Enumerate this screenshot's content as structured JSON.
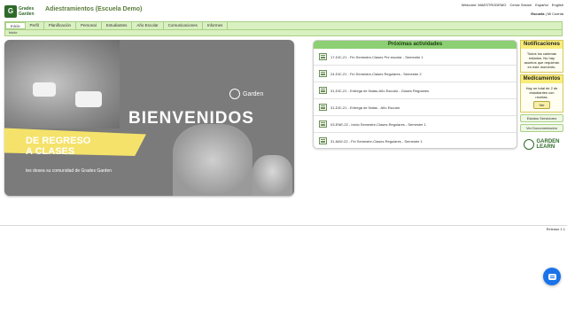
{
  "header": {
    "logo_mark": "G",
    "logo_line1": "Grades",
    "logo_line2": "Garden",
    "title": "Adiestramientos (Escuela Demo)",
    "links": [
      "Welcome: MAESTRODEMO",
      "Cerrar Sesión",
      "Español",
      "English"
    ],
    "school_label": "Escuela",
    "school_value": "| Mi Cuenta"
  },
  "nav": {
    "items": [
      "Inicio",
      "Perfil",
      "Planificación",
      "Personal",
      "Estudiantes",
      "Año Escolar",
      "Comunicaciones",
      "Informes"
    ],
    "active_index": 0,
    "breadcrumb": "Inicio"
  },
  "banner": {
    "brand": "Garden",
    "headline": "BIENVENIDOS",
    "subheadline_line1": "DE REGRESO",
    "subheadline_line2": "A CLASES",
    "tagline": "tes desea su comunidad de Grades Garden"
  },
  "activities": {
    "title": "Próximas actividades",
    "rows": [
      "17-DIC-21 - Fin Semestre-Clases Pre escolar - Semestre 1",
      "24-DIC-21 - Fin Semestre-Clases Regulares - Semestre 2",
      "31-DIC-21 - Entrega de Notas-Año Escolar - Clases Regulares",
      "31-DIC-21 - Entrega de Notas - Año Escolar",
      "03-ENE-22 - Inicio Semestre-Clases Regulares - Semestre 1",
      "31-MAY-22 - Fin Semestre-Clases Regulares - Semestre 1"
    ]
  },
  "sidebar": {
    "notifications_title": "Notificaciones",
    "notifications_body": "Todos los cadenas estados. No hay asuntos que requieran en este momento.",
    "medications_title": "Medicamentos",
    "medications_body": "Hay un total de 2 de estudiantes con recetas.",
    "ver_label": "Ver",
    "estatus_label": "Estatus Servidores",
    "documentacion_label": "Ver Documentación",
    "logo_line1": "GARDEN",
    "logo_line2": "LEARN"
  },
  "footer": {
    "release": "Release 1.1"
  },
  "colors": {
    "nav_bg": "#d9f0c0",
    "activities_header": "#8dcf73",
    "side_header": "#f8ec7a",
    "chat_button": "#1a73e8"
  }
}
